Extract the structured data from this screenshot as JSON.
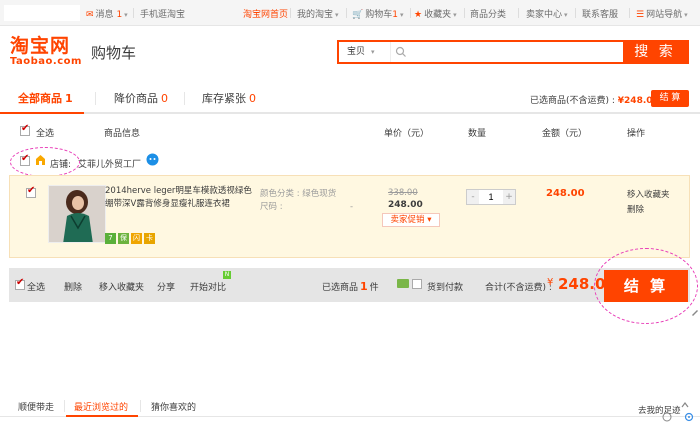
{
  "topbar": {
    "messages_label": "消息",
    "messages_count": "1",
    "mobile": "手机逛淘宝",
    "home": "淘宝网首页",
    "my_taobao": "我的淘宝",
    "cart": "购物车",
    "cart_count": "1",
    "favorites": "收藏夹",
    "categories": "商品分类",
    "seller_center": "卖家中心",
    "contact": "联系客服",
    "sitemap": "网站导航"
  },
  "header": {
    "logo_cn": "淘宝网",
    "logo_en": "Taobao.com",
    "page_title": "购物车",
    "search_category": "宝贝",
    "search_placeholder": "",
    "search_button": "搜 索"
  },
  "tabs": {
    "items": [
      {
        "label": "全部商品",
        "count": "1"
      },
      {
        "label": "降价商品",
        "count": "0"
      },
      {
        "label": "库存紧张",
        "count": "0"
      }
    ],
    "selected_label": "已选商品(不含运费) : ",
    "selected_price": "¥248.00",
    "checkout_small": "结 算"
  },
  "columns": {
    "select_all": "全选",
    "info": "商品信息",
    "unit_price": "单价（元）",
    "quantity": "数量",
    "amount": "金额（元）",
    "actions": "操作"
  },
  "shop": {
    "label": "店铺:",
    "name": "艾菲儿外贸工厂"
  },
  "item": {
    "title": "2014herve leger明星车模款透视绿色绷带深V露背修身显瘦礼服连衣裙",
    "color_label": "颜色分类 : 绿色现货",
    "size_label": "尺码 :",
    "size_value": "-",
    "original_price": "338.00",
    "price": "248.00",
    "promo": "卖家促销",
    "quantity": "1",
    "subtotal": "248.00",
    "move_to_fav": "移入收藏夹",
    "delete": "删除",
    "services": [
      "7",
      "保",
      "闪",
      "卡"
    ]
  },
  "footer": {
    "select_all": "全选",
    "delete": "删除",
    "move_fav": "移入收藏夹",
    "share": "分享",
    "compare": "开始对比",
    "new_badge": "N",
    "selected_prefix": "已选商品",
    "selected_count": "1",
    "selected_suffix": "件",
    "pay_on_delivery": "货到付款",
    "total_label": "合计(不含运费) :",
    "total_currency": "¥",
    "total_amount": "248.00",
    "checkout": "结 算"
  },
  "bottom_tabs": {
    "items": [
      "顺便带走",
      "最近浏览过的",
      "猜你喜欢的"
    ],
    "footprint": "去我的足迹"
  },
  "colors": {
    "accent": "#ff4400",
    "annotation": "#e83fb8",
    "item_bg": "#fff8e1"
  }
}
